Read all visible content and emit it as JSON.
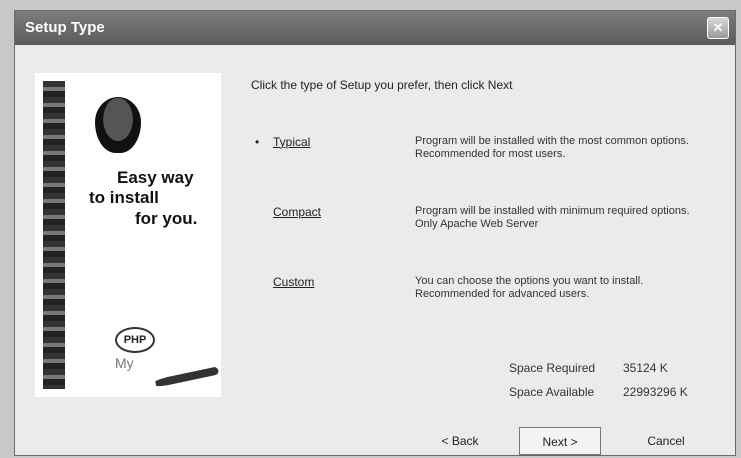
{
  "window": {
    "title": "Setup Type"
  },
  "sidebar_graphic": {
    "slogan_line1": "Easy way",
    "slogan_line2": "to install",
    "slogan_line3": "for you.",
    "badge": "PHP",
    "my_text": "My"
  },
  "instruction": "Click the type of Setup you prefer, then click Next",
  "options": [
    {
      "label": "Typical",
      "selected": true,
      "description": "Program will be installed with the most common options. Recommended for most users."
    },
    {
      "label": "Compact",
      "selected": false,
      "description": "Program will be installed with minimum required options.\nOnly Apache Web Server"
    },
    {
      "label": "Custom",
      "selected": false,
      "description": "You can choose the options you want to install. Recommended for advanced users."
    }
  ],
  "space": {
    "required_label": "Space Required",
    "required_value": "35124 K",
    "available_label": "Space Available",
    "available_value": "22993296 K"
  },
  "buttons": {
    "back": "< Back",
    "next": "Next >",
    "cancel": "Cancel"
  }
}
